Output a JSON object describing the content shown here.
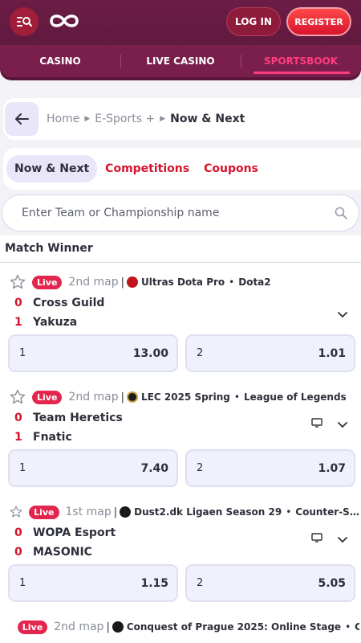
{
  "header": {
    "login_label": "LOG IN",
    "register_label": "REGISTER",
    "brand_color": "#6b1d45",
    "accent_color": "#d6132c"
  },
  "nav": {
    "items": [
      {
        "label": "CASINO"
      },
      {
        "label": "LIVE CASINO"
      },
      {
        "label": "SPORTSBOOK"
      }
    ],
    "active": "SPORTSBOOK"
  },
  "breadcrumb": {
    "items": [
      "Home",
      "E-Sports +",
      "Now & Next"
    ]
  },
  "tabs": {
    "items": [
      "Now & Next",
      "Competitions",
      "Coupons"
    ],
    "active": "Now & Next"
  },
  "search": {
    "placeholder": "Enter Team or Championship name",
    "value": ""
  },
  "market_label": "Match Winner",
  "events": [
    {
      "live_label": "Live",
      "period": "2nd map",
      "competition": "Ultras Dota Pro",
      "game": "Dota2",
      "icon": "dota2-icon",
      "home": {
        "score": "0",
        "name": "Cross Guild"
      },
      "away": {
        "score": "1",
        "name": "Yakuza"
      },
      "stream": false,
      "odds": [
        {
          "sel": "1",
          "price": "13.00"
        },
        {
          "sel": "2",
          "price": "1.01"
        }
      ]
    },
    {
      "live_label": "Live",
      "period": "2nd map",
      "competition": "LEC 2025 Spring",
      "game": "League of Legends",
      "icon": "league-of-legends-icon",
      "home": {
        "score": "0",
        "name": "Team Heretics"
      },
      "away": {
        "score": "1",
        "name": "Fnatic"
      },
      "stream": true,
      "odds": [
        {
          "sel": "1",
          "price": "7.40"
        },
        {
          "sel": "2",
          "price": "1.07"
        }
      ]
    },
    {
      "live_label": "Live",
      "period": "1st map",
      "competition": "Dust2.dk Ligaen Season 29",
      "game": "Counter-Strike",
      "icon": "counter-strike-icon",
      "home": {
        "score": "0",
        "name": "WOPA Esport"
      },
      "away": {
        "score": "0",
        "name": "MASONIC"
      },
      "stream": true,
      "odds": [
        {
          "sel": "1",
          "price": "1.15"
        },
        {
          "sel": "2",
          "price": "5.05"
        }
      ]
    },
    {
      "live_label": "Live",
      "period": "2nd map",
      "competition": "Conquest of Prague 2025: Online Stage",
      "game": "Counter…",
      "icon": "counter-strike-icon"
    }
  ]
}
